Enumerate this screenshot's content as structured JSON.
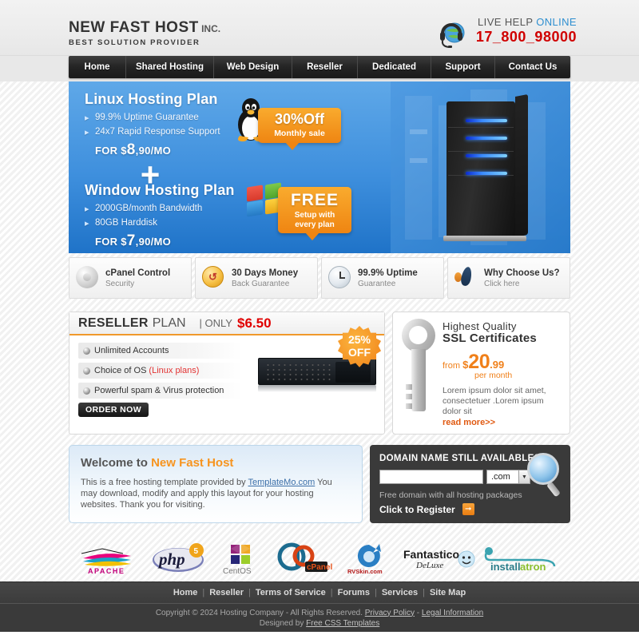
{
  "header": {
    "logo_main": "NEW FAST HOST",
    "logo_inc": " INC.",
    "logo_sub": "BEST SOLUTION PROVIDER",
    "live_help_label": "LIVE HELP ",
    "live_help_status": "ONLINE",
    "phone": "17_800_98000",
    "headset_icon": "headset-globe-icon"
  },
  "nav": {
    "items": [
      {
        "label": "Home"
      },
      {
        "label": "Shared Hosting"
      },
      {
        "label": "Web Design"
      },
      {
        "label": "Reseller"
      },
      {
        "label": "Dedicated"
      },
      {
        "label": "Support"
      },
      {
        "label": "Contact Us"
      }
    ]
  },
  "hero": {
    "linux": {
      "title": "Linux Hosting Plan",
      "bullets": [
        "99.9% Uptime Guarantee",
        "24x7 Rapid Response Support"
      ],
      "price_prefix": "FOR $",
      "price_big": "8",
      "price_rest": ",90/MO"
    },
    "plus": "+",
    "windows": {
      "title": "Window Hosting Plan",
      "bullets": [
        "2000GB/month Bandwidth",
        "80GB Harddisk"
      ],
      "price_prefix": "FOR $",
      "price_big": "7",
      "price_rest": ",90/MO"
    },
    "badge_linux": {
      "main": "30%Off",
      "sub": "Monthly sale"
    },
    "badge_windows": {
      "main": "FREE",
      "sub_line1": "Setup with",
      "sub_line2": "every plan"
    },
    "server_image_alt": "black-tower-server-image",
    "accent_blue": "#3e8fdd",
    "accent_orange": "#ef8512"
  },
  "features": [
    {
      "icon": "gear-icon",
      "title": "cPanel Control",
      "sub": "Security"
    },
    {
      "icon": "coin-icon",
      "title": "30 Days Money",
      "sub": "Back Guarantee"
    },
    {
      "icon": "clock-icon",
      "title": "99.9% Uptime",
      "sub": "Guarantee"
    },
    {
      "icon": "pin-drop-icon",
      "title": "Why Choose Us?",
      "sub": "Click here"
    }
  ],
  "reseller": {
    "title_strong": "RESELLER",
    "title_light": "PLAN",
    "only_label": "| ONLY",
    "price": "$6.50",
    "items": [
      {
        "text": "Unlimited Accounts",
        "highlight": ""
      },
      {
        "text": "Choice of OS",
        "highlight": "(Linux plans)"
      },
      {
        "text": "Powerful spam & Virus protection",
        "highlight": ""
      }
    ],
    "order_button": "ORDER NOW",
    "starburst_line1": "25%",
    "starburst_line2": "OFF",
    "hdd_image_alt": "rack-server-image"
  },
  "ssl": {
    "title_line1": "Highest  Quality",
    "title_line2": "SSL Certificates",
    "from_label": "from ",
    "currency": "$",
    "amount": "20",
    "cents": ".99",
    "per_month": "per month",
    "description": "Lorem ipsum dolor sit amet, consectetuer .Lorem ipsum dolor sit",
    "read_more": "read more>>",
    "key_icon": "key-icon"
  },
  "welcome": {
    "title_prefix": "Welcome to ",
    "title_brand": "New Fast Host",
    "text_before": "This is a free hosting template provided by ",
    "link": "TemplateMo.com",
    "text_after": " You may download, modify and apply this layout for your hosting websites. Thank you for visiting."
  },
  "domain": {
    "title": "DOMAIN NAME STILL AVAILABLE?",
    "input_value": "",
    "input_placeholder": "",
    "tld_selected": ".com",
    "note": "Free domain with all hosting packages",
    "cta": "Click to Register",
    "arrow_icon": "arrow-right-icon",
    "magnifier_icon": "magnifier-globe-icon"
  },
  "partners": [
    {
      "name": "apache-logo",
      "label": "APACHE"
    },
    {
      "name": "php-logo",
      "label": "php"
    },
    {
      "name": "centos-logo",
      "label": "CentOS"
    },
    {
      "name": "cpanel-logo",
      "label": "cPanel"
    },
    {
      "name": "rvskin-logo",
      "label": "RVSkin.com"
    },
    {
      "name": "fantastico-logo",
      "label": "Fantastico"
    },
    {
      "name": "installatron-logo",
      "label": "installatron"
    }
  ],
  "footer": {
    "links": [
      "Home",
      "Reseller",
      "Terms of Service",
      "Forums",
      "Services",
      "Site Map"
    ],
    "copyright": "Copyright © 2024 Hosting Company - All Rights Reserved.",
    "privacy": "Privacy Policy",
    "dash": " - ",
    "legal": "Legal Information",
    "designed_by": "Designed by ",
    "designer": "Free CSS Templates"
  }
}
